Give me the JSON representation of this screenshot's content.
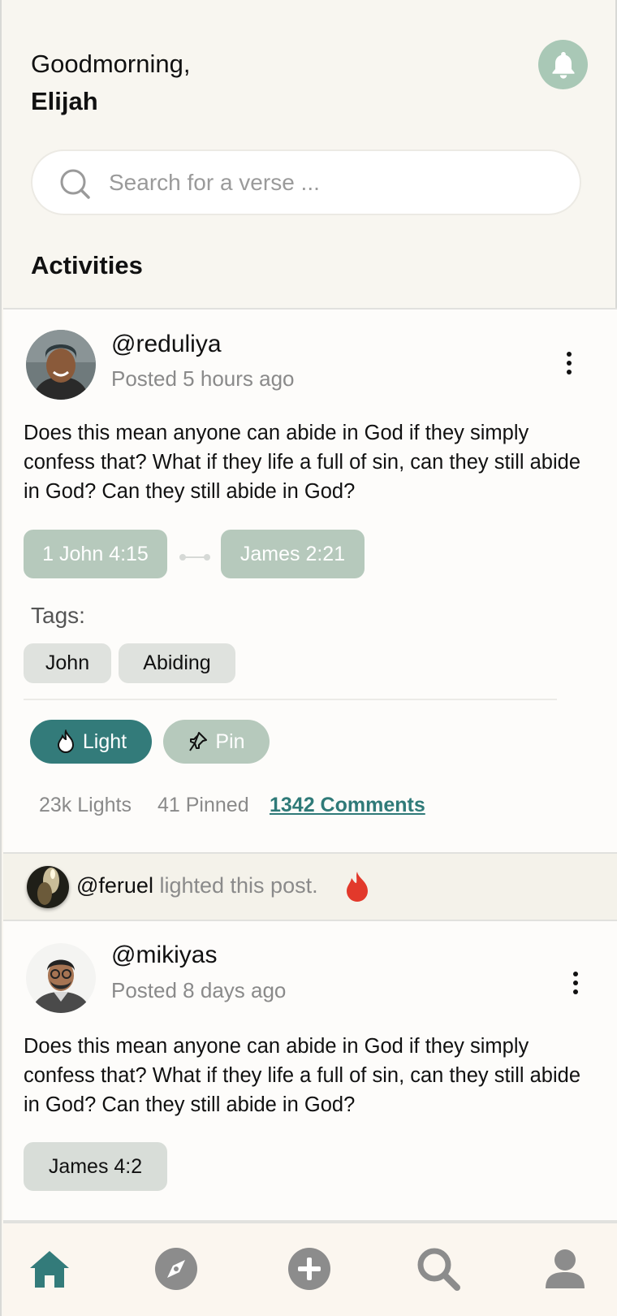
{
  "header": {
    "greeting": "Goodmorning,",
    "name": "Elijah"
  },
  "search": {
    "placeholder": "Search for a verse ..."
  },
  "section_title": "Activities",
  "posts": [
    {
      "username": "@reduliya",
      "posted": "Posted 5 hours ago",
      "body": "Does this mean anyone can abide in God if they simply confess that? What if they life a full of sin, can they still abide in God? Can they still abide in God?",
      "verses": [
        "1 John 4:15",
        "James 2:21"
      ],
      "tags_label": "Tags:",
      "tags": [
        "John",
        "Abiding"
      ],
      "actions": {
        "light": "Light",
        "pin": "Pin"
      },
      "stats": {
        "lights": "23k Lights",
        "pinned": "41 Pinned",
        "comments": "1342 Comments"
      }
    },
    {
      "username": "@mikiyas",
      "posted": "Posted 8 days ago",
      "body": "Does this mean anyone can abide in God if they simply confess that? What if they life a full of sin, can they still abide in God? Can they still abide in God?",
      "verses": [
        "James 4:2"
      ]
    }
  ],
  "activity": {
    "user": "@feruel",
    "action": "lighted this post."
  },
  "tabbar": {
    "items": [
      "home-icon",
      "compass-icon",
      "add-icon",
      "search-icon",
      "profile-icon"
    ]
  },
  "colors": {
    "accent": "#337b7a",
    "sage": "#b6c9bc",
    "bell": "#a9c8b6",
    "fire": "#e2392b",
    "background": "#f8f6f0"
  }
}
